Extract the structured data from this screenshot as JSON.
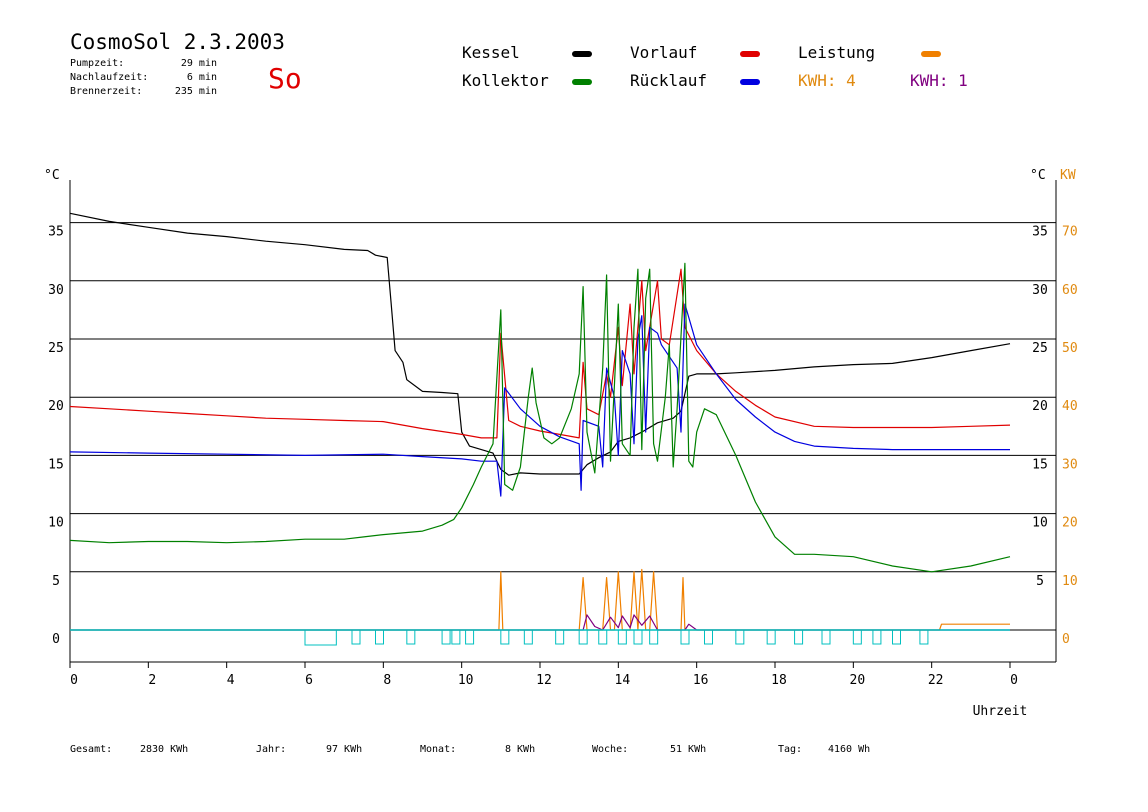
{
  "header": {
    "title": "CosmoSol 2.3.2003",
    "day": "So",
    "stats": [
      {
        "label": "Pumpzeit:",
        "value": "29 min"
      },
      {
        "label": "Nachlaufzeit:",
        "value": "6 min"
      },
      {
        "label": "Brennerzeit:",
        "value": "235 min"
      }
    ]
  },
  "legend": {
    "items": [
      {
        "label": "Kessel",
        "color": "#000000"
      },
      {
        "label": "Kollektor",
        "color": "#008000"
      },
      {
        "label": "Vorlauf",
        "color": "#e00000"
      },
      {
        "label": "Rücklauf",
        "color": "#0000e0"
      },
      {
        "label": "Leistung",
        "color": "#f08000"
      }
    ],
    "kwh": [
      {
        "label": "KWH: 4",
        "color": "#e08a10"
      },
      {
        "label": "KWH: 1",
        "color": "#800080"
      }
    ]
  },
  "footer": {
    "items": [
      {
        "label": "Gesamt:",
        "value": "2830 KWh"
      },
      {
        "label": "Jahr:",
        "value": "97 KWh"
      },
      {
        "label": "Monat:",
        "value": "8 KWh"
      },
      {
        "label": "Woche:",
        "value": "51 KWh"
      },
      {
        "label": "Tag:",
        "value": "4160 Wh"
      }
    ]
  },
  "chart_data": {
    "type": "line",
    "xlabel": "Uhrzeit",
    "ylabel_left": "°C",
    "ylabel_right": "°C",
    "ylabel_right2": "KW",
    "xlim": [
      0,
      24
    ],
    "ylim": [
      0,
      35
    ],
    "x_ticks": [
      "0",
      "2",
      "4",
      "6",
      "8",
      "10",
      "12",
      "14",
      "16",
      "18",
      "20",
      "22",
      "0"
    ],
    "y_ticks_left": [
      "0",
      "5",
      "10",
      "15",
      "20",
      "25",
      "30",
      "35"
    ],
    "y_ticks_right": [
      "5",
      "10",
      "15",
      "20",
      "25",
      "30",
      "35"
    ],
    "y_ticks_kw": [
      "0",
      "10",
      "20",
      "30",
      "40",
      "50",
      "60",
      "70"
    ],
    "grid": true,
    "colors": {
      "kw_axis": "#e08a10",
      "pump": "#00c0c0"
    },
    "series": [
      {
        "name": "Kessel",
        "color": "#000000",
        "points": [
          [
            0,
            35.8
          ],
          [
            1,
            35.1
          ],
          [
            2,
            34.6
          ],
          [
            3,
            34.1
          ],
          [
            4,
            33.8
          ],
          [
            5,
            33.4
          ],
          [
            6,
            33.1
          ],
          [
            7,
            32.7
          ],
          [
            7.6,
            32.6
          ],
          [
            7.8,
            32.2
          ],
          [
            8.1,
            32.0
          ],
          [
            8.2,
            28.0
          ],
          [
            8.3,
            24.0
          ],
          [
            8.5,
            23.0
          ],
          [
            8.6,
            21.5
          ],
          [
            9,
            20.5
          ],
          [
            9.5,
            20.4
          ],
          [
            9.9,
            20.3
          ],
          [
            10,
            17.0
          ],
          [
            10.2,
            15.8
          ],
          [
            10.5,
            15.5
          ],
          [
            10.8,
            15.2
          ],
          [
            11.0,
            13.8
          ],
          [
            11.2,
            13.3
          ],
          [
            11.5,
            13.5
          ],
          [
            12,
            13.4
          ],
          [
            12.5,
            13.4
          ],
          [
            13,
            13.4
          ],
          [
            13.2,
            14.2
          ],
          [
            13.5,
            14.8
          ],
          [
            13.8,
            15.3
          ],
          [
            14.0,
            16.2
          ],
          [
            14.3,
            16.5
          ],
          [
            14.6,
            17.0
          ],
          [
            15.0,
            17.8
          ],
          [
            15.4,
            18.2
          ],
          [
            15.6,
            18.8
          ],
          [
            15.8,
            21.8
          ],
          [
            16,
            22.0
          ],
          [
            16.5,
            22.0
          ],
          [
            17,
            22.1
          ],
          [
            18,
            22.3
          ],
          [
            19,
            22.6
          ],
          [
            20,
            22.8
          ],
          [
            21,
            22.9
          ],
          [
            22,
            23.4
          ],
          [
            23,
            24.0
          ],
          [
            24,
            24.6
          ]
        ]
      },
      {
        "name": "Vorlauf",
        "color": "#e00000",
        "points": [
          [
            0,
            19.2
          ],
          [
            1,
            19.0
          ],
          [
            2,
            18.8
          ],
          [
            3,
            18.6
          ],
          [
            4,
            18.4
          ],
          [
            5,
            18.2
          ],
          [
            6,
            18.1
          ],
          [
            7,
            18.0
          ],
          [
            8,
            17.9
          ],
          [
            9,
            17.3
          ],
          [
            10,
            16.8
          ],
          [
            10.5,
            16.5
          ],
          [
            10.9,
            16.5
          ],
          [
            11.0,
            25.5
          ],
          [
            11.2,
            18.0
          ],
          [
            11.5,
            17.5
          ],
          [
            12,
            17.1
          ],
          [
            12.5,
            16.8
          ],
          [
            13,
            16.5
          ],
          [
            13.1,
            23.0
          ],
          [
            13.2,
            19.0
          ],
          [
            13.5,
            18.5
          ],
          [
            13.7,
            22.0
          ],
          [
            13.8,
            20.0
          ],
          [
            14.0,
            26.0
          ],
          [
            14.1,
            21.0
          ],
          [
            14.3,
            28.0
          ],
          [
            14.4,
            22.0
          ],
          [
            14.6,
            30.0
          ],
          [
            14.7,
            24.0
          ],
          [
            15.0,
            30.0
          ],
          [
            15.1,
            25.0
          ],
          [
            15.3,
            24.5
          ],
          [
            15.6,
            31.0
          ],
          [
            15.7,
            26.0
          ],
          [
            16,
            24.0
          ],
          [
            16.5,
            22.0
          ],
          [
            17,
            20.5
          ],
          [
            17.5,
            19.3
          ],
          [
            18,
            18.3
          ],
          [
            19,
            17.5
          ],
          [
            20,
            17.4
          ],
          [
            21,
            17.4
          ],
          [
            22,
            17.4
          ],
          [
            23,
            17.5
          ],
          [
            24,
            17.6
          ]
        ]
      },
      {
        "name": "Rücklauf",
        "color": "#0000e0",
        "points": [
          [
            0,
            15.3
          ],
          [
            2,
            15.2
          ],
          [
            4,
            15.1
          ],
          [
            6,
            15.0
          ],
          [
            8,
            15.1
          ],
          [
            9,
            14.9
          ],
          [
            10,
            14.7
          ],
          [
            10.5,
            14.5
          ],
          [
            10.9,
            14.5
          ],
          [
            11.0,
            11.5
          ],
          [
            11.1,
            20.8
          ],
          [
            11.5,
            19.0
          ],
          [
            12,
            17.5
          ],
          [
            12.5,
            16.6
          ],
          [
            13,
            16.0
          ],
          [
            13.05,
            12.0
          ],
          [
            13.1,
            18.0
          ],
          [
            13.5,
            17.5
          ],
          [
            13.6,
            14.0
          ],
          [
            13.7,
            22.5
          ],
          [
            13.9,
            20.0
          ],
          [
            14.0,
            15.0
          ],
          [
            14.1,
            24.0
          ],
          [
            14.3,
            22.0
          ],
          [
            14.4,
            16.0
          ],
          [
            14.5,
            25.0
          ],
          [
            14.6,
            27.0
          ],
          [
            14.7,
            17.0
          ],
          [
            14.8,
            26.0
          ],
          [
            15.0,
            25.5
          ],
          [
            15.1,
            24.5
          ],
          [
            15.5,
            22.5
          ],
          [
            15.6,
            17.0
          ],
          [
            15.7,
            28.0
          ],
          [
            16,
            24.5
          ],
          [
            16.5,
            22.0
          ],
          [
            17,
            19.8
          ],
          [
            17.5,
            18.3
          ],
          [
            18,
            17.0
          ],
          [
            18.5,
            16.2
          ],
          [
            19,
            15.8
          ],
          [
            20,
            15.6
          ],
          [
            21,
            15.5
          ],
          [
            22,
            15.5
          ],
          [
            23,
            15.5
          ],
          [
            24,
            15.5
          ]
        ]
      },
      {
        "name": "Kollektor",
        "color": "#008000",
        "points": [
          [
            0,
            7.7
          ],
          [
            1,
            7.5
          ],
          [
            2,
            7.6
          ],
          [
            3,
            7.6
          ],
          [
            4,
            7.5
          ],
          [
            5,
            7.6
          ],
          [
            6,
            7.8
          ],
          [
            7,
            7.8
          ],
          [
            7.5,
            8.0
          ],
          [
            8,
            8.2
          ],
          [
            9,
            8.5
          ],
          [
            9.5,
            9.0
          ],
          [
            9.8,
            9.5
          ],
          [
            10,
            10.5
          ],
          [
            10.3,
            12.5
          ],
          [
            10.5,
            14.0
          ],
          [
            10.8,
            16.0
          ],
          [
            11.0,
            27.5
          ],
          [
            11.1,
            12.5
          ],
          [
            11.3,
            12.0
          ],
          [
            11.5,
            14.0
          ],
          [
            11.7,
            20.0
          ],
          [
            11.8,
            22.5
          ],
          [
            11.9,
            19.5
          ],
          [
            12.1,
            16.5
          ],
          [
            12.3,
            16.0
          ],
          [
            12.5,
            16.5
          ],
          [
            12.8,
            19.0
          ],
          [
            13.0,
            22.0
          ],
          [
            13.1,
            29.5
          ],
          [
            13.2,
            17.0
          ],
          [
            13.4,
            13.5
          ],
          [
            13.6,
            22.5
          ],
          [
            13.7,
            30.5
          ],
          [
            13.8,
            14.5
          ],
          [
            13.9,
            21.0
          ],
          [
            14.0,
            28.0
          ],
          [
            14.1,
            16.0
          ],
          [
            14.3,
            15.0
          ],
          [
            14.4,
            26.0
          ],
          [
            14.5,
            31.0
          ],
          [
            14.6,
            15.5
          ],
          [
            14.7,
            28.5
          ],
          [
            14.8,
            31.0
          ],
          [
            14.9,
            16.0
          ],
          [
            15.0,
            14.5
          ],
          [
            15.2,
            20.0
          ],
          [
            15.3,
            24.5
          ],
          [
            15.4,
            14.0
          ],
          [
            15.5,
            19.0
          ],
          [
            15.7,
            31.5
          ],
          [
            15.8,
            14.5
          ],
          [
            15.9,
            14.0
          ],
          [
            16.0,
            17.0
          ],
          [
            16.2,
            19.0
          ],
          [
            16.5,
            18.5
          ],
          [
            17,
            15.0
          ],
          [
            17.5,
            11.0
          ],
          [
            18,
            8.0
          ],
          [
            18.5,
            6.5
          ],
          [
            19,
            6.5
          ],
          [
            20,
            6.3
          ],
          [
            21,
            5.5
          ],
          [
            22,
            5.0
          ],
          [
            23,
            5.5
          ],
          [
            24,
            6.3
          ]
        ]
      },
      {
        "name": "Leistung",
        "color": "#f08000",
        "points": [
          [
            0,
            0
          ],
          [
            10.95,
            0
          ],
          [
            11.0,
            5
          ],
          [
            11.05,
            0
          ],
          [
            13.0,
            0
          ],
          [
            13.1,
            4.5
          ],
          [
            13.2,
            0
          ],
          [
            13.6,
            0
          ],
          [
            13.7,
            4.5
          ],
          [
            13.8,
            0
          ],
          [
            13.9,
            0
          ],
          [
            14.0,
            5
          ],
          [
            14.1,
            0
          ],
          [
            14.3,
            0
          ],
          [
            14.4,
            5
          ],
          [
            14.5,
            0
          ],
          [
            14.6,
            5.2
          ],
          [
            14.7,
            0
          ],
          [
            14.8,
            0
          ],
          [
            14.9,
            5
          ],
          [
            15.0,
            0
          ],
          [
            15.6,
            0
          ],
          [
            15.65,
            4.5
          ],
          [
            15.7,
            0
          ],
          [
            22.2,
            0
          ],
          [
            22.25,
            0.5
          ],
          [
            24,
            0.5
          ]
        ]
      },
      {
        "name": "KWH",
        "color": "#800080",
        "points": [
          [
            0,
            0
          ],
          [
            13.1,
            0
          ],
          [
            13.2,
            1.3
          ],
          [
            13.4,
            0.3
          ],
          [
            13.6,
            0
          ],
          [
            13.8,
            1.1
          ],
          [
            14.0,
            0.2
          ],
          [
            14.1,
            1.2
          ],
          [
            14.3,
            0.2
          ],
          [
            14.4,
            1.3
          ],
          [
            14.6,
            0.4
          ],
          [
            14.8,
            1.2
          ],
          [
            15.0,
            0
          ],
          [
            15.7,
            0
          ],
          [
            15.8,
            0.5
          ],
          [
            16.0,
            0
          ],
          [
            24,
            0
          ]
        ]
      }
    ]
  }
}
